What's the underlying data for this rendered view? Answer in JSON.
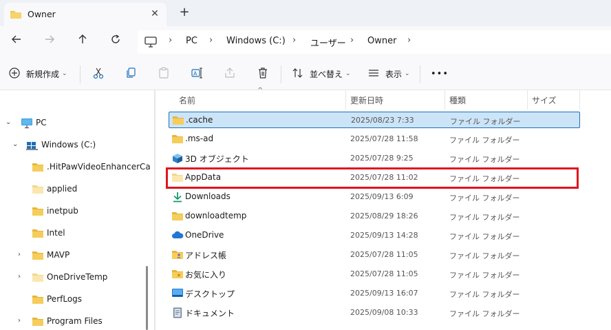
{
  "tab": {
    "title": "Owner",
    "close": "✕",
    "new": "+"
  },
  "breadcrumb": [
    "PC",
    "Windows (C:)",
    "ユーザー",
    "Owner"
  ],
  "toolbar": {
    "new_label": "新規作成",
    "sort_label": "並べ替え",
    "view_label": "表示",
    "more_label": "•••"
  },
  "sidebar": {
    "items": [
      {
        "label": "PC",
        "icon": "monitor-icon",
        "expanded": true
      },
      {
        "label": "Windows (C:)",
        "icon": "drive-icon",
        "expanded": true
      },
      {
        "label": ".HitPawVideoEnhancerCach",
        "icon": "folder-icon"
      },
      {
        "label": "applied",
        "icon": "folder-icon"
      },
      {
        "label": "inetpub",
        "icon": "folder-icon"
      },
      {
        "label": "Intel",
        "icon": "folder-icon"
      },
      {
        "label": "MAVP",
        "icon": "folder-icon",
        "has_children": true
      },
      {
        "label": "OneDriveTemp",
        "icon": "folder-icon",
        "has_children": true
      },
      {
        "label": "PerfLogs",
        "icon": "folder-icon"
      },
      {
        "label": "Program Files",
        "icon": "folder-icon",
        "has_children": true
      }
    ]
  },
  "columns": {
    "name": "名前",
    "date": "更新日時",
    "type": "種類",
    "size": "サイズ"
  },
  "files": [
    {
      "name": ".cache",
      "date": "2025/08/23 7:33",
      "type": "ファイル フォルダー",
      "icon": "folder-icon",
      "selected": true
    },
    {
      "name": ".ms-ad",
      "date": "2025/07/28 11:58",
      "type": "ファイル フォルダー",
      "icon": "folder-icon"
    },
    {
      "name": "3D オブジェクト",
      "date": "2025/07/28 9:25",
      "type": "ファイル フォルダー",
      "icon": "cube-3d-icon"
    },
    {
      "name": "AppData",
      "date": "2025/07/28 11:02",
      "type": "ファイル フォルダー",
      "icon": "hidden-folder-icon",
      "highlighted": true
    },
    {
      "name": "Downloads",
      "date": "2025/09/13 6:09",
      "type": "ファイル フォルダー",
      "icon": "download-arrow-icon"
    },
    {
      "name": "downloadtemp",
      "date": "2025/08/29 18:26",
      "type": "ファイル フォルダー",
      "icon": "folder-icon"
    },
    {
      "name": "OneDrive",
      "date": "2025/09/13 14:28",
      "type": "ファイル フォルダー",
      "icon": "cloud-icon"
    },
    {
      "name": "アドレス帳",
      "date": "2025/07/28 11:05",
      "type": "ファイル フォルダー",
      "icon": "contacts-folder-icon"
    },
    {
      "name": "お気に入り",
      "date": "2025/07/28 11:05",
      "type": "ファイル フォルダー",
      "icon": "favorites-folder-icon"
    },
    {
      "name": "デスクトップ",
      "date": "2025/09/13 16:07",
      "type": "ファイル フォルダー",
      "icon": "desktop-icon"
    },
    {
      "name": "ドキュメント",
      "date": "2025/09/08 10:33",
      "type": "ファイル フォルダー",
      "icon": "document-icon"
    }
  ],
  "colors": {
    "folder": "#f3c54f",
    "selection": "#cce4f7",
    "selection_border": "#1e6fb8",
    "highlight_red": "#e0141e"
  }
}
